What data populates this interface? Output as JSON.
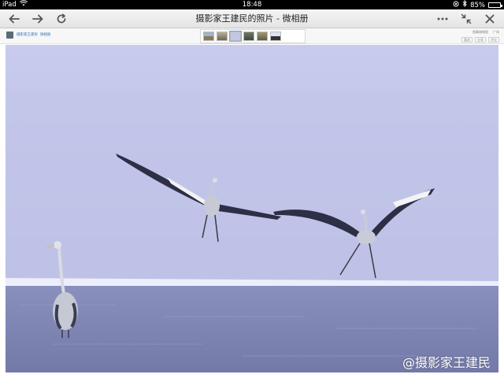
{
  "status_bar": {
    "device": "iPad",
    "time": "18:48",
    "battery": "85%",
    "battery_level": 0.85
  },
  "toolbar": {
    "back_icon": "arrow-left-icon",
    "forward_icon": "arrow-right-icon",
    "reload_icon": "reload-icon",
    "page_title": "摄影家王建民的照片 - 微相册",
    "more_icon": "more-dots-icon",
    "shrink_icon": "shrink-icon",
    "close_icon": "close-icon"
  },
  "page_header": {
    "author": "摄影家王建民",
    "album": "微相册",
    "header_links": [
      "隐藏缩略图",
      "广场"
    ],
    "action_buttons": [
      "喜欢",
      "分享",
      "评论"
    ]
  },
  "photo": {
    "watermark": "@摄影家王建民",
    "colors": {
      "sky": "#c5c8ea",
      "water": "#7f86b4",
      "ice": "#e8eaf8"
    }
  }
}
